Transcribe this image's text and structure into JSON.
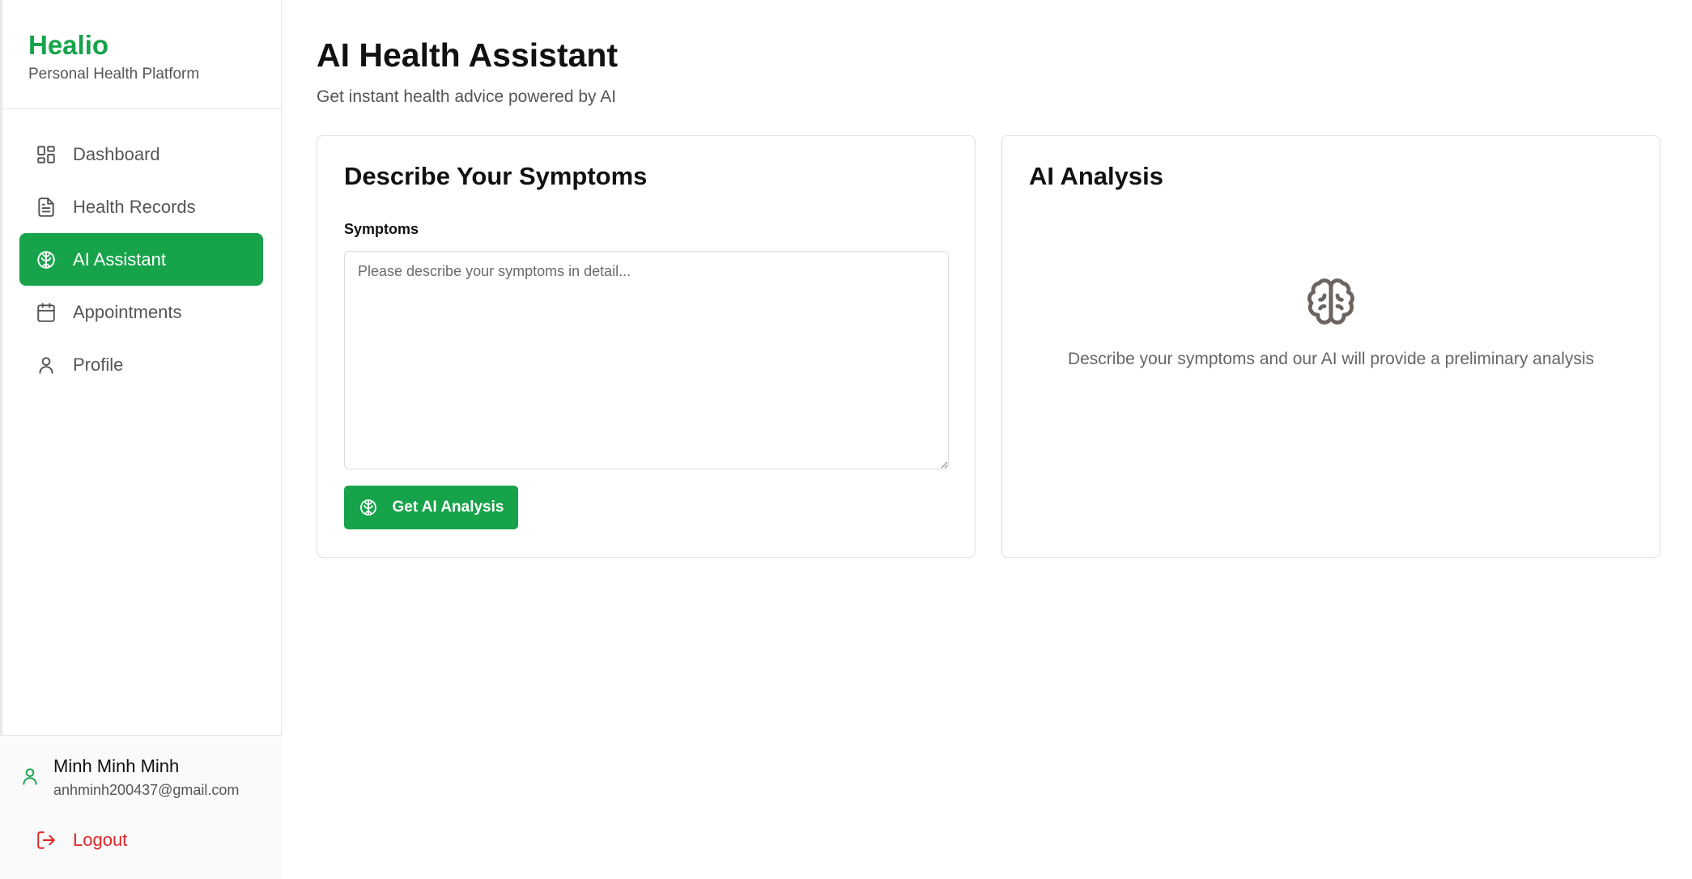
{
  "brand": {
    "name": "Healio",
    "tagline": "Personal Health Platform"
  },
  "nav": {
    "items": [
      {
        "label": "Dashboard",
        "icon": "dashboard-grid-icon",
        "active": false
      },
      {
        "label": "Health Records",
        "icon": "document-icon",
        "active": false
      },
      {
        "label": "AI Assistant",
        "icon": "brain-icon",
        "active": true
      },
      {
        "label": "Appointments",
        "icon": "calendar-icon",
        "active": false
      },
      {
        "label": "Profile",
        "icon": "user-icon",
        "active": false
      }
    ]
  },
  "user": {
    "name": "Minh Minh Minh",
    "email": "anhminh200437@gmail.com",
    "icon": "user-icon"
  },
  "logout": {
    "label": "Logout",
    "icon": "logout-icon"
  },
  "page": {
    "title": "AI Health Assistant",
    "subtitle": "Get instant health advice powered by AI"
  },
  "symptoms_card": {
    "title": "Describe Your Symptoms",
    "field_label": "Symptoms",
    "placeholder": "Please describe your symptoms in detail...",
    "value": "",
    "button_label": "Get AI Analysis",
    "button_icon": "brain-icon"
  },
  "analysis_card": {
    "title": "AI Analysis",
    "empty_icon": "brain-icon",
    "empty_text": "Describe your symptoms and our AI will provide a preliminary analysis"
  },
  "colors": {
    "brand": "#16a34a",
    "danger": "#dc2626",
    "muted_text": "#555555"
  }
}
